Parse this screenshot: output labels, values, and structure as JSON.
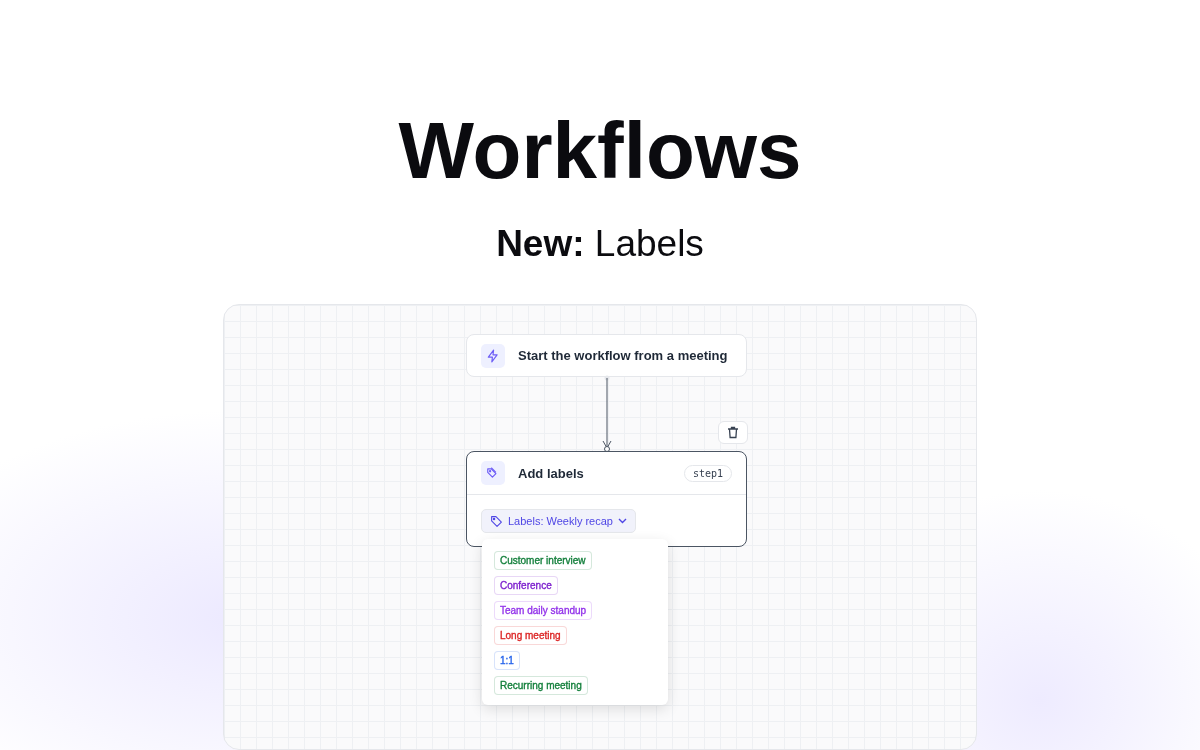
{
  "heading": "Workflows",
  "subheading": "**New:** Labels",
  "trigger_node": {
    "label": "Start the workflow from a meeting"
  },
  "action_node": {
    "title": "Add labels",
    "step_badge": "step1",
    "labels_button": "Labels: Weekly recap"
  },
  "label_menu": [
    {
      "label": "Customer interview",
      "color": "#15803d"
    },
    {
      "label": "Conference",
      "color": "#7e22ce"
    },
    {
      "label": "Team daily standup",
      "color": "#9333ea"
    },
    {
      "label": "Long meeting",
      "color": "#dc2626"
    },
    {
      "label": "1:1",
      "color": "#2563eb"
    },
    {
      "label": "Recurring meeting",
      "color": "#15803d"
    }
  ]
}
